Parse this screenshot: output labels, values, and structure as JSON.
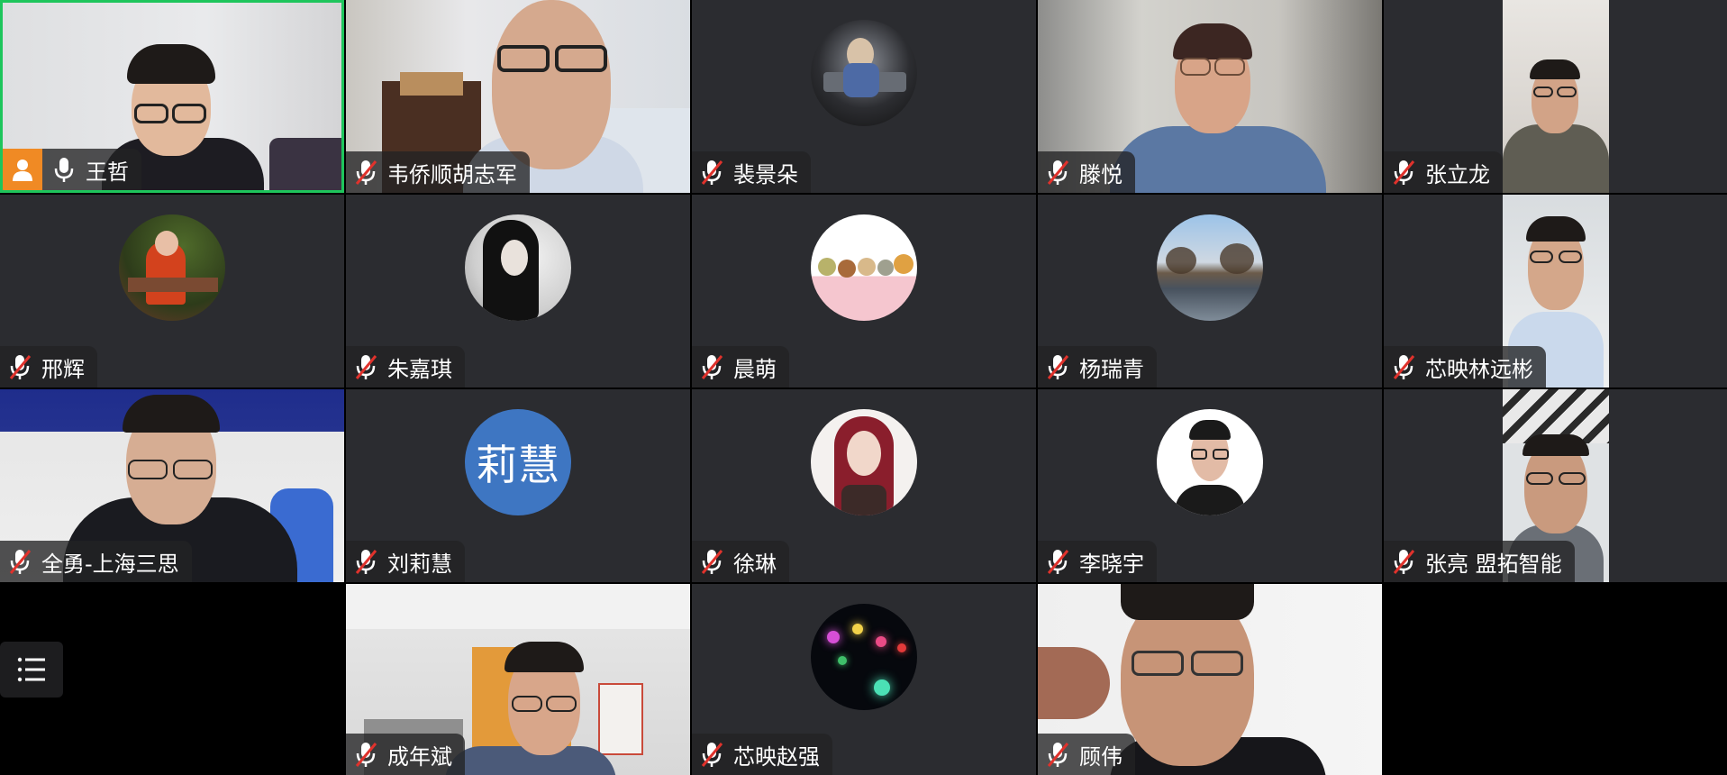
{
  "participants": [
    {
      "name": "王哲",
      "mic": "on",
      "host": true,
      "active": true,
      "type": "video"
    },
    {
      "name": "韦侨顺胡志军",
      "mic": "muted",
      "type": "video"
    },
    {
      "name": "裴景朵",
      "mic": "muted",
      "type": "avatar"
    },
    {
      "name": "滕悦",
      "mic": "muted",
      "type": "video"
    },
    {
      "name": "张立龙",
      "mic": "muted",
      "type": "video"
    },
    {
      "name": "邢辉",
      "mic": "muted",
      "type": "avatar"
    },
    {
      "name": "朱嘉琪",
      "mic": "muted",
      "type": "avatar"
    },
    {
      "name": "晨萌",
      "mic": "muted",
      "type": "avatar"
    },
    {
      "name": "杨瑞青",
      "mic": "muted",
      "type": "avatar"
    },
    {
      "name": "芯映林远彬",
      "mic": "muted",
      "type": "video"
    },
    {
      "name": "全勇-上海三思",
      "mic": "muted",
      "type": "video"
    },
    {
      "name": "刘莉慧",
      "mic": "muted",
      "type": "text-avatar",
      "avatar_text": "莉慧"
    },
    {
      "name": "徐琳",
      "mic": "muted",
      "type": "avatar"
    },
    {
      "name": "李晓宇",
      "mic": "muted",
      "type": "avatar"
    },
    {
      "name": "张亮 盟拓智能",
      "mic": "muted",
      "type": "video"
    },
    {
      "name": "成年斌",
      "mic": "muted",
      "type": "video"
    },
    {
      "name": "芯映赵强",
      "mic": "muted",
      "type": "avatar"
    },
    {
      "name": "顾伟",
      "mic": "muted",
      "type": "video"
    }
  ],
  "colors": {
    "active_border": "#1ec55c",
    "host_badge": "#f08a24",
    "muted": "#e0322c",
    "tile_bg": "#2b2c30"
  },
  "icons": {
    "mic": "microphone-icon",
    "muted": "microphone-muted-icon",
    "host": "host-person-icon",
    "menu": "list-menu-icon"
  }
}
